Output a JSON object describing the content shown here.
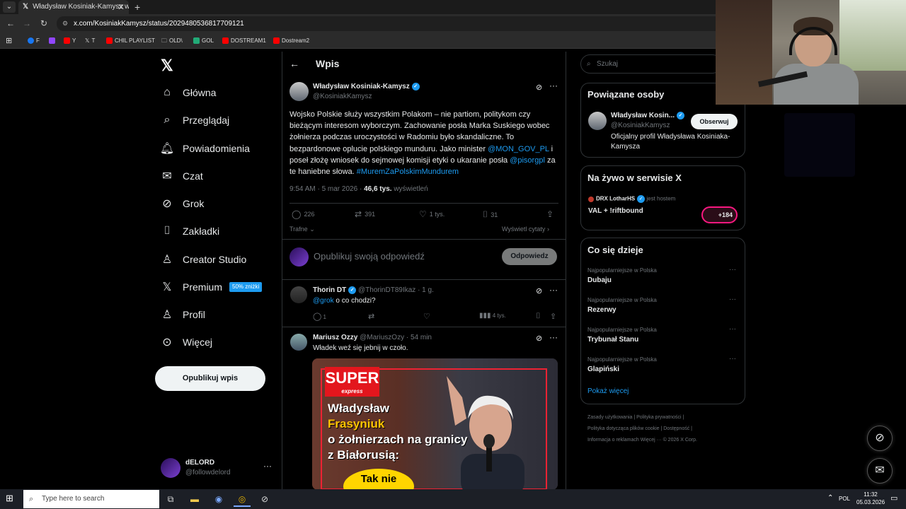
{
  "browser": {
    "tab_title": "Władysław Kosiniak-Kamysz w",
    "url": "x.com/KosiniakKamysz/status/2029480536817709121",
    "bookmarks": [
      "F",
      "Y",
      "T",
      "CHIL PLAYLIST",
      "OLD\\",
      "GOL",
      "DOSTREAM1",
      "Dostream2"
    ]
  },
  "nav": {
    "items": [
      "Główna",
      "Przeglądaj",
      "Powiadomienia",
      "Czat",
      "Grok",
      "Zakładki",
      "Creator Studio",
      "Premium",
      "Profil",
      "Więcej"
    ],
    "premium_badge": "50% zniżki",
    "publish_label": "Opublikuj wpis",
    "user_name": "dELORD",
    "user_handle": "@followdelord"
  },
  "post": {
    "page_title": "Wpis",
    "author_name": "Władysław Kosiniak-Kamysz",
    "author_handle": "@KosiniakKamysz",
    "text_1": "Wojsko Polskie służy wszystkim Polakom – nie partiom, politykom czy bieżącym interesom wyborczym. Zachowanie posła Marka Suskiego wobec żołnierza podczas uroczystości w Radomiu było skandaliczne. To bezpardonowe oplucie polskiego munduru. Jako minister ",
    "mention_1": "@MON_GOV_PL",
    "text_2": " i poseł złożę wniosek do sejmowej komisji etyki o ukaranie posła ",
    "mention_2": "@pisorgpl",
    "text_3": " za te haniebne słowa. ",
    "hashtag": "#MuremZaPolskimMundurem",
    "time": "9:54 AM · 5 mar 2026 · ",
    "views": "46,6 tys.",
    "views_label": " wyświetleń",
    "replies": "226",
    "reposts": "391",
    "likes": "1 tys.",
    "bookmarks": "31",
    "sort_label": "Trafne",
    "quotes_label": "Wyświetl cytaty",
    "reply_placeholder": "Opublikuj swoją odpowiedź",
    "reply_button": "Odpowiedz"
  },
  "replies": [
    {
      "name": "Thorin DT",
      "handle": "@ThorinDT89Ikaz · 1 g.",
      "mention": "@grok",
      "text": " o co chodzi?",
      "replies": "1",
      "views": "4 tys."
    },
    {
      "name": "Mariusz Ozzy",
      "handle": "@MariuszOzy · 54 min",
      "text": "Władek weź się jebnij w czoło.",
      "media": {
        "brand": "SUPER",
        "brand_sub": "express",
        "headline_1": "Władysław",
        "headline_2": "Frasyniuk",
        "headline_3": "o żołnierzach na granicy z Białorusią:",
        "bubble": "Tak nie"
      }
    }
  ],
  "right": {
    "search_placeholder": "Szukaj",
    "related_title": "Powiązane osoby",
    "related_name": "Władysław Kosin...",
    "related_handle": "@KosiniakKamysz",
    "related_follow": "Obserwuj",
    "related_bio": "Oficjalny profil Władysława Kosiniaka-Kamysza",
    "live_title": "Na żywo w serwisie X",
    "live_host_name": "DRX LotharHS",
    "live_host_suffix": " jest hostem",
    "live_show": "VAL + !riftbound",
    "live_count": "+184",
    "trends_title": "Co się dzieje",
    "trends": [
      {
        "category": "Najpopularniejsze w Polska",
        "name": "Dubaju"
      },
      {
        "category": "Najpopularniejsze w Polska",
        "name": "Rezerwy"
      },
      {
        "category": "Najpopularniejsze w Polska",
        "name": "Trybunał Stanu"
      },
      {
        "category": "Najpopularniejsze w Polska",
        "name": "Glapiński"
      }
    ],
    "show_more": "Pokaż więcej",
    "footer_1": "Zasady użytkowania  |  Polityka prywatności  |",
    "footer_2": "Polityka dotycząca plików cookie  |  Dostępność  |",
    "footer_3": "Informacja o reklamach   Więcej ···   © 2026 X Corp."
  },
  "taskbar": {
    "search_placeholder": "Type here to search",
    "lang": "POL",
    "time": "11:32",
    "date": "05.03.2026"
  },
  "colors": {
    "accent": "#1d9bf0",
    "background": "#000000",
    "border": "#2f3336",
    "muted": "#71767b"
  }
}
